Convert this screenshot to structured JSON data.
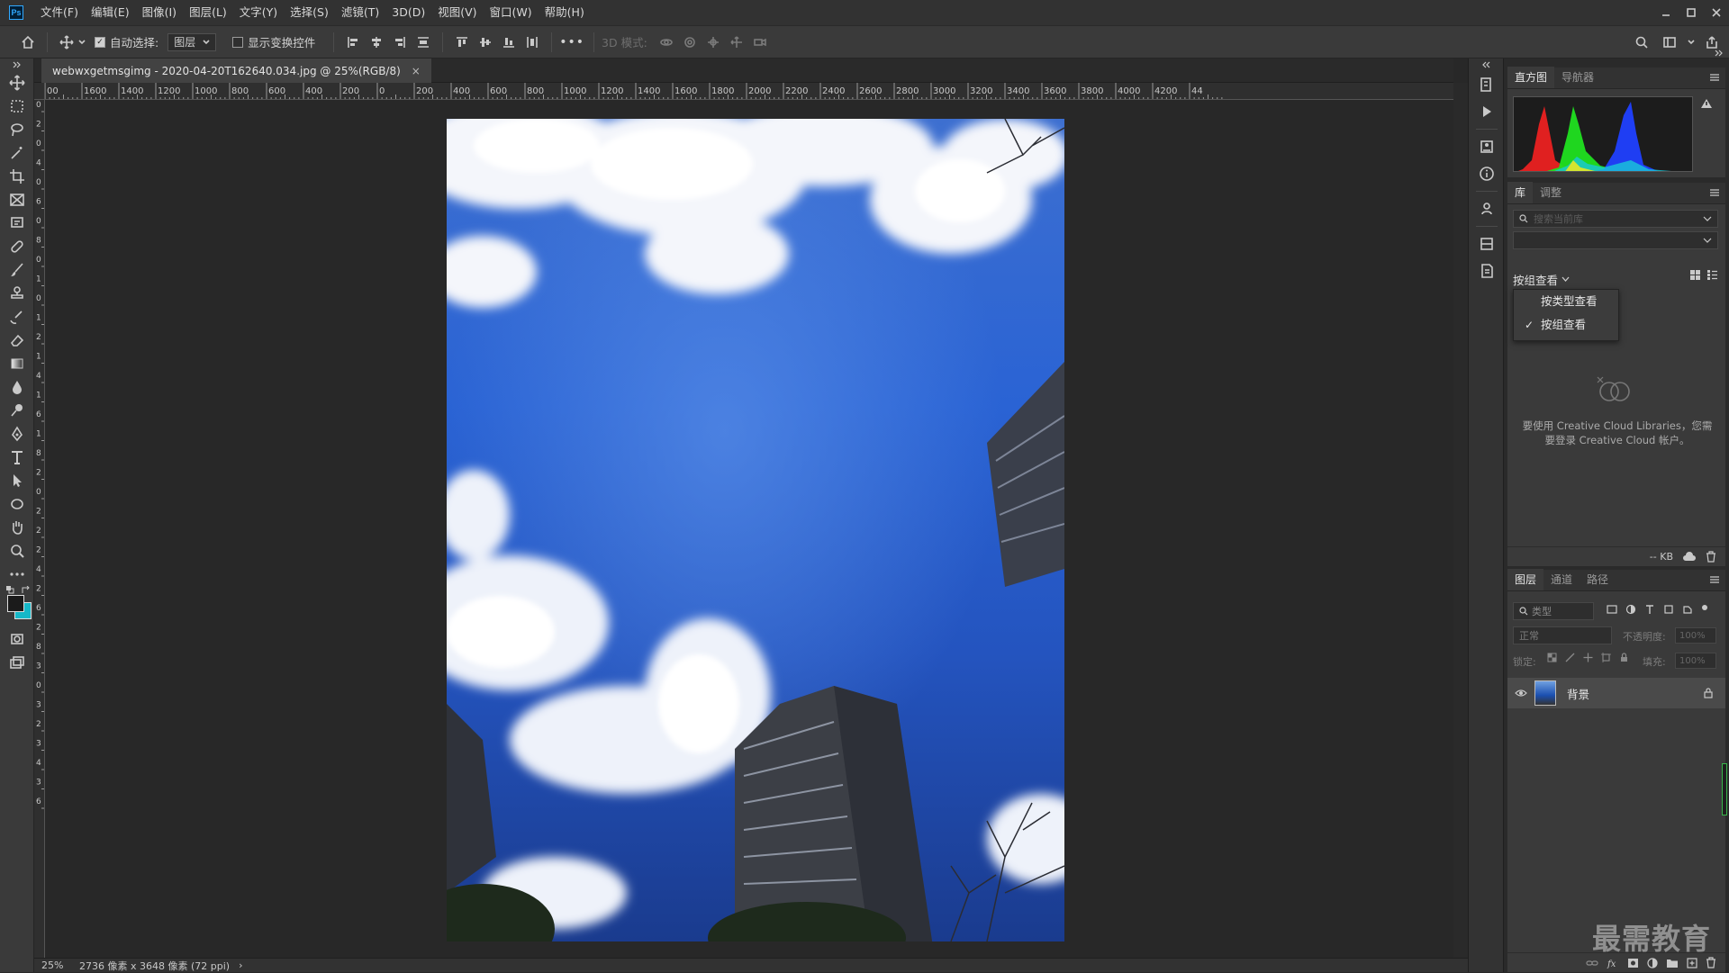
{
  "app": {
    "logo": "Ps"
  },
  "menu": [
    "文件(F)",
    "编辑(E)",
    "图像(I)",
    "图层(L)",
    "文字(Y)",
    "选择(S)",
    "滤镜(T)",
    "3D(D)",
    "视图(V)",
    "窗口(W)",
    "帮助(H)"
  ],
  "options": {
    "auto_select_label": "自动选择:",
    "auto_select_target": "图层",
    "show_transform_label": "显示变换控件",
    "more_label": "•••",
    "mode_3d_label": "3D 模式:"
  },
  "document": {
    "tab_title": "webwxgetmsgimg - 2020-04-20T162640.034.jpg @ 25%(RGB/8)",
    "close_glyph": "×"
  },
  "rulers": {
    "top": [
      "00",
      "1600",
      "1400",
      "1200",
      "1000",
      "800",
      "600",
      "400",
      "200",
      "0",
      "200",
      "400",
      "600",
      "800",
      "1000",
      "1200",
      "1400",
      "1600",
      "1800",
      "2000",
      "2200",
      "2400",
      "2600",
      "2800",
      "3000",
      "3200",
      "3400",
      "3600",
      "3800",
      "4000",
      "4200",
      "44"
    ],
    "left": [
      "0",
      "2",
      "0",
      "4",
      "0",
      "6",
      "0",
      "8",
      "0",
      "1",
      "0",
      "1",
      "2",
      "1",
      "4",
      "1",
      "6",
      "1",
      "8",
      "2",
      "0",
      "2",
      "2",
      "2",
      "4",
      "2",
      "6",
      "2",
      "8",
      "3",
      "0",
      "3",
      "2",
      "3",
      "4",
      "3",
      "6"
    ]
  },
  "status": {
    "zoom": "25%",
    "doc_info": "2736 像素 x 3648 像素 (72 ppi)",
    "arrow": "›"
  },
  "histogram_panel": {
    "tabs": [
      "直方图",
      "导航器"
    ]
  },
  "library_panel": {
    "tabs": [
      "库",
      "调整"
    ],
    "search_placeholder": "搜索当前库",
    "view_by_label": "按组查看",
    "dropdown": [
      {
        "label": "按类型查看",
        "checked": false
      },
      {
        "label": "按组查看",
        "checked": true
      }
    ],
    "check_glyph": "✓",
    "cc_message": "要使用 Creative Cloud Libraries，您需要登录 Creative Cloud 帐户。",
    "size_label": "-- KB"
  },
  "layers_panel": {
    "tabs": [
      "图层",
      "通道",
      "路径"
    ],
    "filter_label": "类型",
    "blend_mode": "正常",
    "opacity_label": "不透明度:",
    "opacity_value": "100%",
    "lock_label": "锁定:",
    "fill_label": "填充:",
    "fill_value": "100%",
    "layers": [
      {
        "name": "背景",
        "visible": true,
        "locked": true
      }
    ]
  },
  "watermark": "最需教育",
  "colors": {
    "foreground": "#1b1b1b",
    "background": "#16b8c8",
    "accent": "#31a8ff"
  }
}
